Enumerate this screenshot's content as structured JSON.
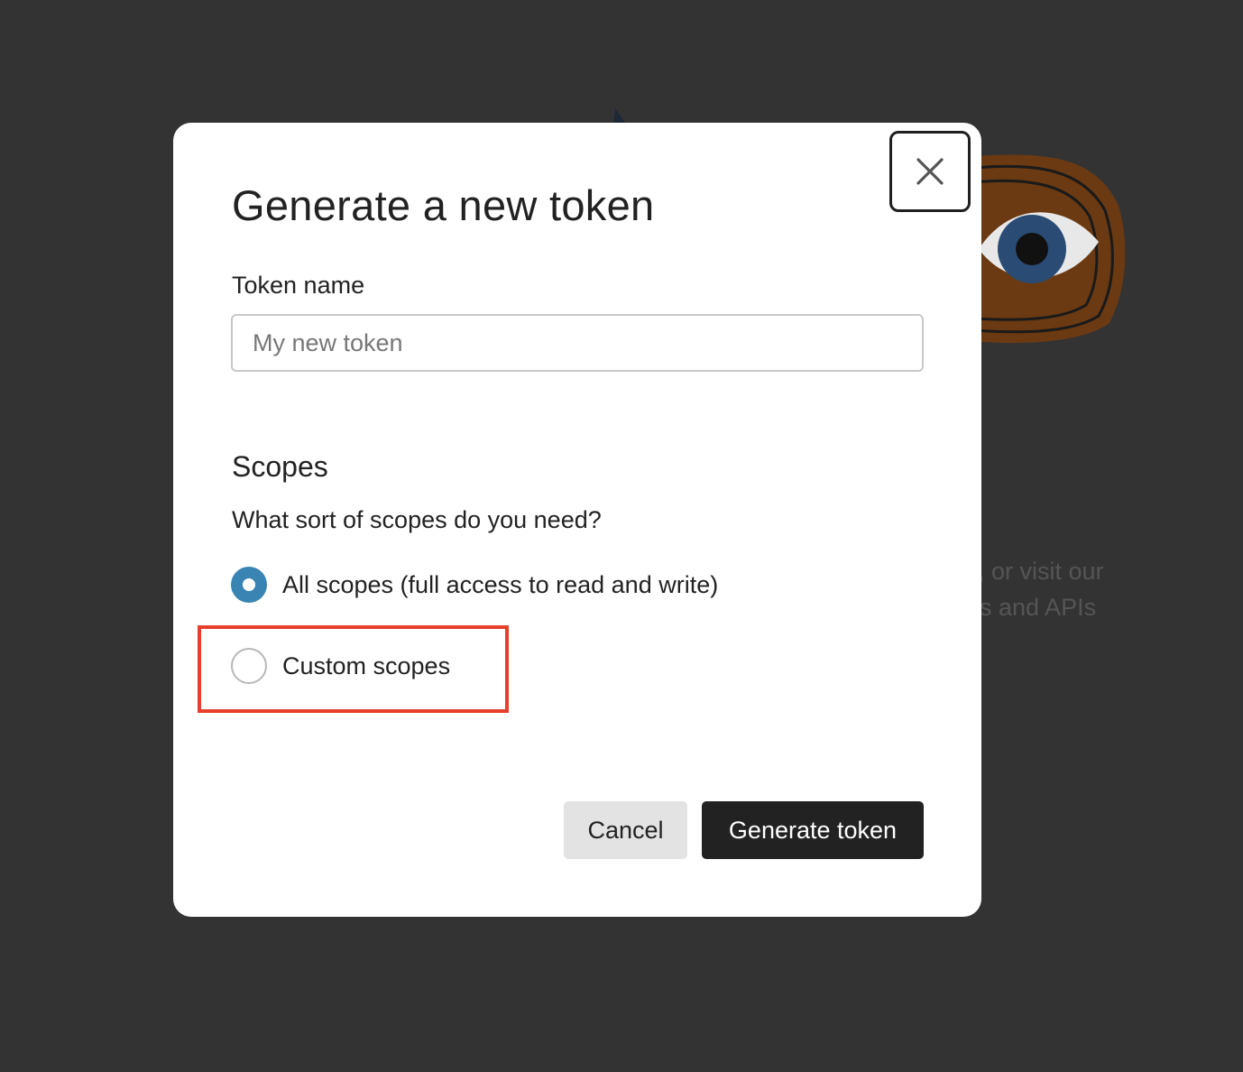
{
  "background": {
    "text_line_1": ", or visit our",
    "text_line_2": "s and APIs"
  },
  "modal": {
    "title": "Generate a new token",
    "close_icon": "close-icon",
    "token_name": {
      "label": "Token name",
      "value": "",
      "placeholder": "My new token"
    },
    "scopes": {
      "heading": "Scopes",
      "question": "What sort of scopes do you need?",
      "options": [
        {
          "label": "All scopes (full access to read and write)",
          "selected": true
        },
        {
          "label": "Custom scopes",
          "selected": false
        }
      ],
      "highlighted_option": "Custom scopes"
    },
    "actions": {
      "cancel_label": "Cancel",
      "generate_label": "Generate token"
    }
  },
  "colors": {
    "overlay": "#333333",
    "radio_selected": "#3a84b3",
    "highlight": "#e5402a",
    "primary_button": "#222222",
    "secondary_button": "#e3e3e3"
  }
}
